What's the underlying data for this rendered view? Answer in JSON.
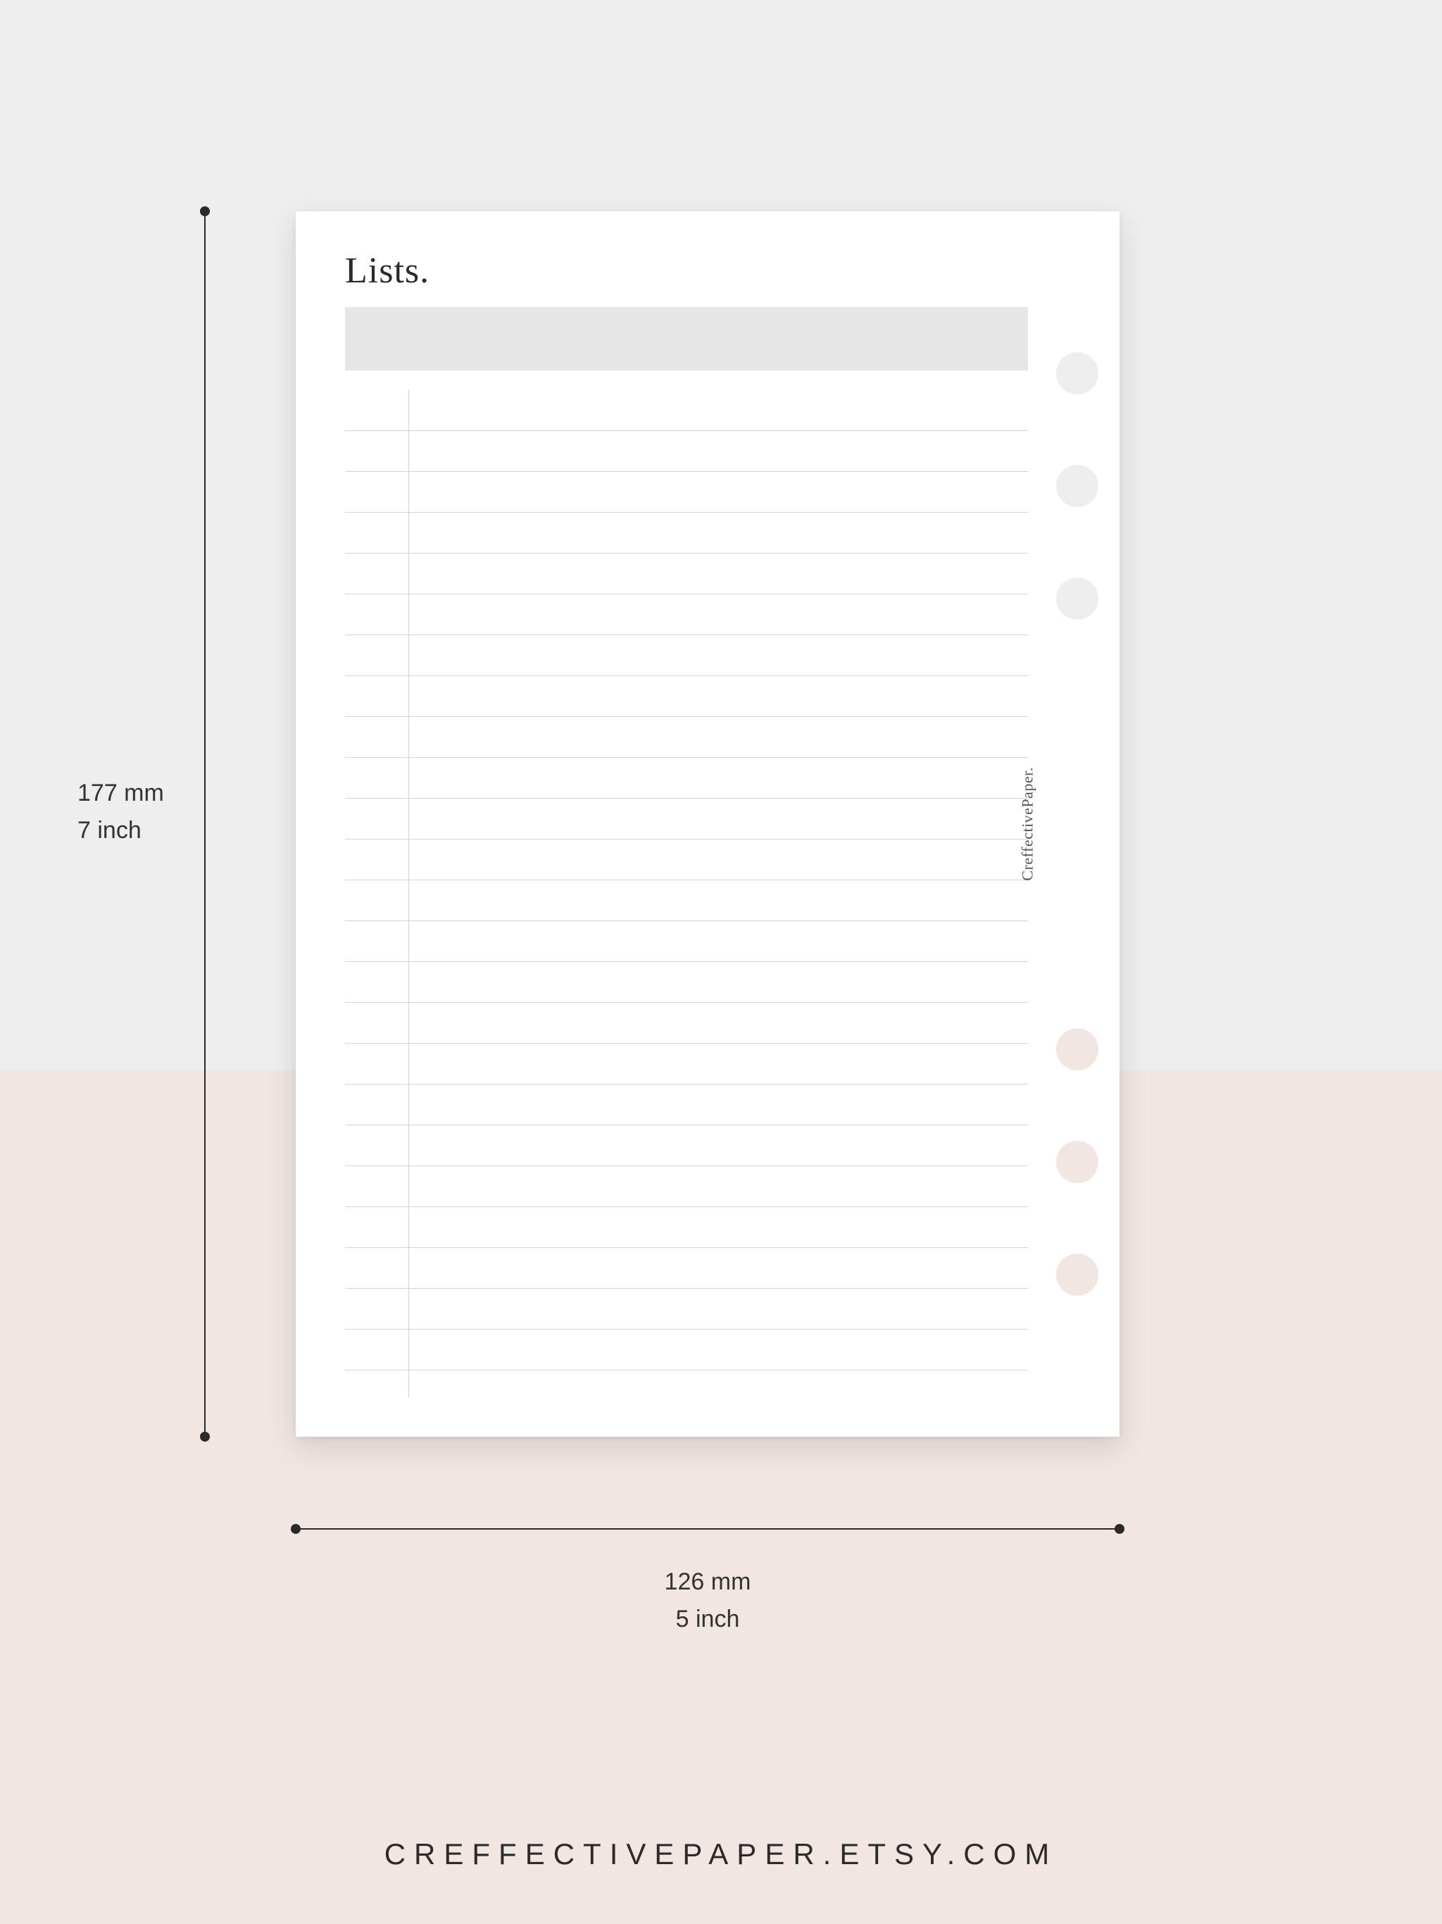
{
  "dimensions": {
    "height_mm": "177 mm",
    "height_in": "7 inch",
    "width_mm": "126 mm",
    "width_in": "5 inch"
  },
  "page": {
    "title": "Lists.",
    "side_brand": "CreffectivePaper.",
    "rule_line_count": 24,
    "binder_hole_count": 6
  },
  "footer": {
    "brand": "CREFFECTIVEPAPER.ETSY.COM"
  },
  "colors": {
    "bg_top": "#eeeeee",
    "bg_bottom": "#f1e6e1",
    "paper": "#ffffff",
    "title_bar": "#e6e6e6",
    "rule": "#d6d6d6",
    "text": "#2b2b2b"
  }
}
